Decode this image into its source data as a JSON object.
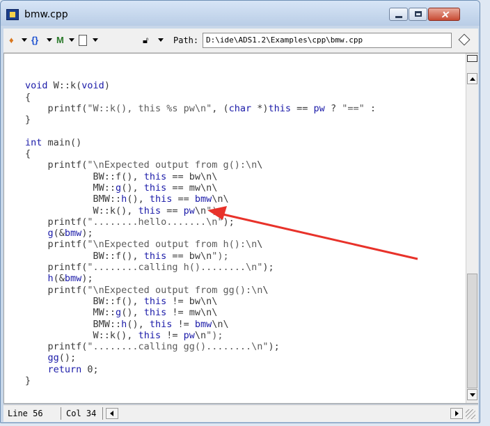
{
  "window": {
    "title": "bmw.cpp"
  },
  "toolbar": {
    "braces_glyph": "{}",
    "path_label": "Path:",
    "path_value": "D:\\ide\\ADS1.2\\Examples\\cpp\\bmw.cpp",
    "icons": [
      "function-menu-icon",
      "braces-menu-icon",
      "marker-menu-icon",
      "file-menu-icon",
      "lock-icon",
      "sync-icon"
    ]
  },
  "code_lines": [
    "",
    "void W::k(void)",
    "{",
    "    printf(\"W::k(), this %s pw\\n\", (char *)this == pw ? \"==\" :",
    "}",
    "",
    "int main()",
    "{",
    "    printf(\"\\nExpected output from g():\\n\\",
    "            BW::f(), this == bw\\n\\",
    "            MW::g(), this == mw\\n\\",
    "            BMW::h(), this == bmw\\n\\",
    "            W::k(), this == pw\\n\");",
    "    printf(\"........hello.......\\n\");",
    "    g(&bmw);",
    "    printf(\"\\nExpected output from h():\\n\\",
    "            BW::f(), this == bw\\n\");",
    "    printf(\"........calling h()........\\n\");",
    "    h(&bmw);",
    "    printf(\"\\nExpected output from gg():\\n\\",
    "            BW::f(), this != bw\\n\\",
    "            MW::g(), this != mw\\n\\",
    "            BMW::h(), this != bmw\\n\\",
    "            W::k(), this != pw\\n\");",
    "    printf(\"........calling gg()........\\n\");",
    "    gg();",
    "    return 0;",
    "}"
  ],
  "status": {
    "line": "Line 56",
    "col": "Col 34"
  },
  "colors": {
    "keyword": "#1a1aa8",
    "annotation_arrow": "#e8322a"
  }
}
